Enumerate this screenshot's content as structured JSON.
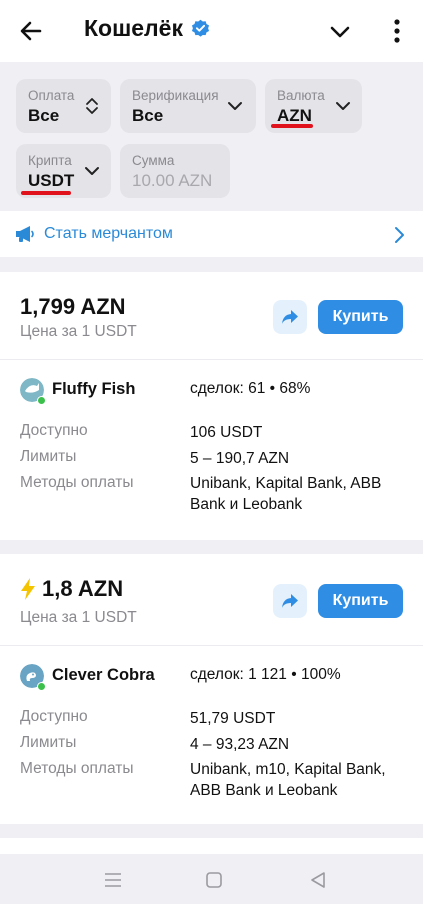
{
  "header": {
    "title": "Кошелёк"
  },
  "filters": {
    "payment": {
      "label": "Оплата",
      "value": "Все"
    },
    "verification": {
      "label": "Верификация",
      "value": "Все"
    },
    "currency": {
      "label": "Валюта",
      "value": "AZN"
    },
    "crypto": {
      "label": "Крипта",
      "value": "USDT"
    },
    "amount": {
      "label": "Сумма",
      "placeholder": "10.00 AZN"
    }
  },
  "merchant": {
    "label": "Стать мерчантом"
  },
  "offers": [
    {
      "price": "1,799 AZN",
      "per": "Цена за 1 USDT",
      "buy_label": "Купить",
      "user": "Fluffy Fish",
      "deals": "сделок: 61 • 68%",
      "available_label": "Доступно",
      "available": "106 USDT",
      "limits_label": "Лимиты",
      "limits": "5 – 190,7 AZN",
      "methods_label": "Методы оплаты",
      "methods": "Unibank, Kapital Bank, ABB Bank и Leobank"
    },
    {
      "price": "1,8 AZN",
      "per": "Цена за 1 USDT",
      "buy_label": "Купить",
      "user": "Clever Cobra",
      "deals": "сделок: 1 121 • 100%",
      "available_label": "Доступно",
      "available": "51,79 USDT",
      "limits_label": "Лимиты",
      "limits": "4 – 93,23 AZN",
      "methods_label": "Методы оплаты",
      "methods": "Unibank, m10, Kapital Bank, ABB Bank и Leobank"
    }
  ],
  "colors": {
    "accent": "#2f8ee4",
    "underline": "#e0121c",
    "online": "#3cc04c"
  }
}
